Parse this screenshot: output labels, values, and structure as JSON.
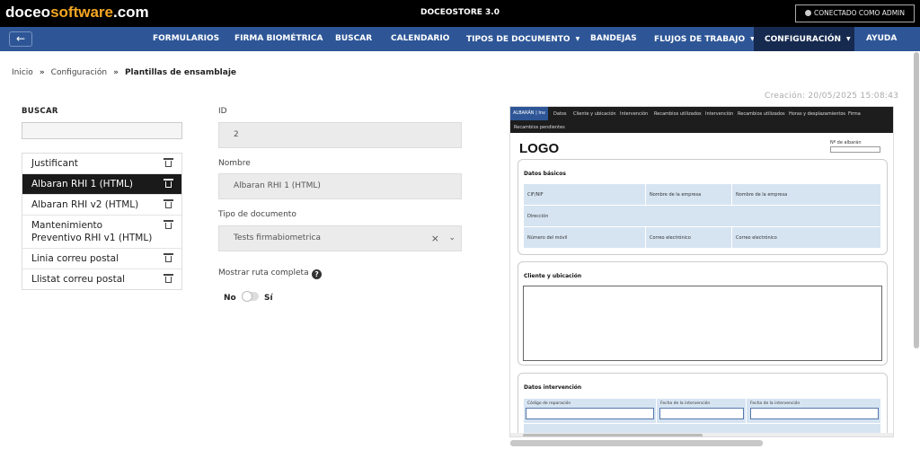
{
  "header": {
    "logo_part1": "doceo",
    "logo_part2": "software",
    "logo_part3": ".com",
    "app_title": "DOCEOSTORE 3.0",
    "user_button": "CONECTADO COMO ADMIN"
  },
  "nav": {
    "back_icon": "arrow-left-icon",
    "items": [
      {
        "label": "FORMULARIOS"
      },
      {
        "label": "FIRMA BIOMÉTRICA"
      },
      {
        "label": "BUSCAR"
      },
      {
        "label": "CALENDARIO"
      },
      {
        "label": "TIPOS DE DOCUMENTO",
        "caret": "▼"
      },
      {
        "label": "BANDEJAS"
      },
      {
        "label": "FLUJOS DE TRABAJO",
        "caret": "▼"
      },
      {
        "label": "CONFIGURACIÓN",
        "caret": "▼"
      },
      {
        "label": "AYUDA"
      }
    ]
  },
  "breadcrumb": {
    "items": [
      "Inicio",
      "Configuración",
      "Plantillas de ensamblaje"
    ],
    "separator": "»"
  },
  "left": {
    "search_label": "BUSCAR",
    "search_value": "",
    "templates": [
      {
        "label": "Justificant",
        "selected": false
      },
      {
        "label": "Albaran RHI 1 (HTML)",
        "selected": true
      },
      {
        "label": "Albaran RHI v2 (HTML)",
        "selected": false
      },
      {
        "label": "Mantenimiento Preventivo RHI v1 (HTML)",
        "selected": false
      },
      {
        "label": "Linia correu postal",
        "selected": false
      },
      {
        "label": "Llistat correu postal",
        "selected": false
      }
    ]
  },
  "form": {
    "id_label": "ID",
    "id_value": "2",
    "name_label": "Nombre",
    "name_value": "Albaran RHI 1 (HTML)",
    "doctype_label": "Tipo de documento",
    "doctype_value": "Tests firmabiometrica",
    "clear_glyph": "×",
    "chevron_glyph": "⌄",
    "show_path_label": "Mostrar ruta completa",
    "help_glyph": "?",
    "toggle_off": "No",
    "toggle_on": "Sí",
    "toggle_state": false
  },
  "preview": {
    "created": "Creación:  20/05/2025 15:08:43",
    "tabs": [
      "ALBARÁN | Inv",
      "Datos",
      "Cliente y ubicación",
      "Intervención",
      "Recambios utilizados",
      "Intervención",
      "Recambios utilizados",
      "Horas y desplazamientos",
      "Firma",
      "Recambios pendientes"
    ],
    "logo": "LOGO",
    "albaran_label": "Nº de albarán",
    "card1_title": "Datos básicos",
    "card1_rows": [
      [
        "CIF/NIF",
        "Nombre de la empresa",
        "Nombre de la empresa"
      ],
      [
        "Dirección"
      ],
      [
        "Número del móvil",
        "Correo electrónico",
        "Correo electrónico"
      ]
    ],
    "card2_title": "Cliente y ubicación",
    "card3_title": "Datos intervención",
    "card3_labels": [
      "Código de reparación",
      "Fecha de la intervención",
      "Fecha de la intervención"
    ]
  }
}
